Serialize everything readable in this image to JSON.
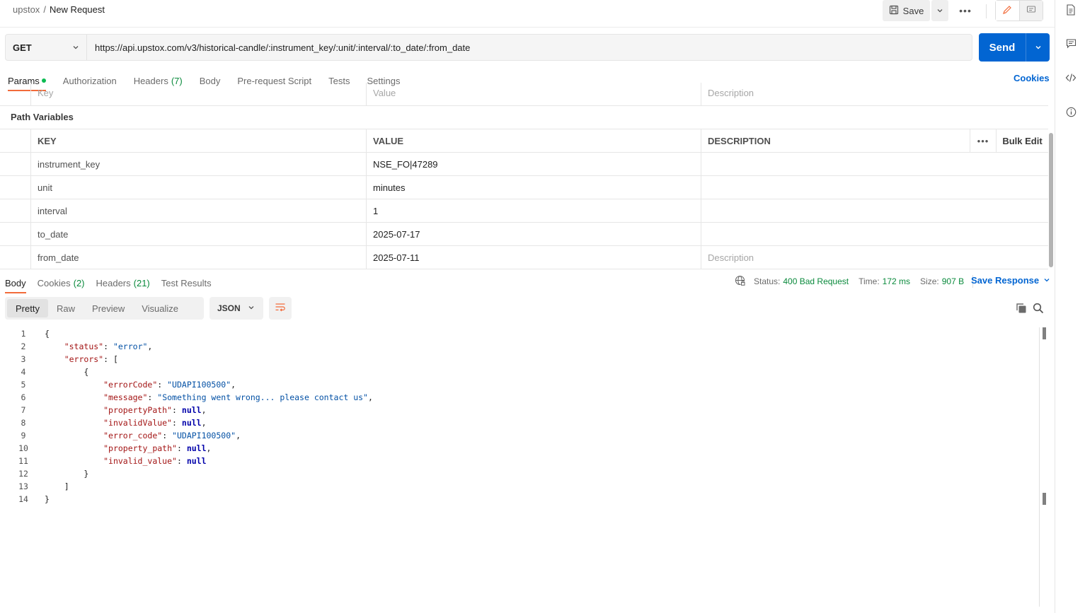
{
  "header": {
    "workspace": "upstox",
    "separator": "/",
    "request_name": "New Request",
    "save_label": "Save",
    "more_label": "•••"
  },
  "request": {
    "method": "GET",
    "url": "https://api.upstox.com/v3/historical-candle/:instrument_key/:unit/:interval/:to_date/:from_date",
    "send_label": "Send"
  },
  "req_tabs": {
    "params": "Params",
    "authorization": "Authorization",
    "headers": "Headers",
    "headers_count": "(7)",
    "body": "Body",
    "pre_request": "Pre-request Script",
    "tests": "Tests",
    "settings": "Settings",
    "cookies": "Cookies"
  },
  "query_params": {
    "key_placeholder": "Key",
    "value_placeholder": "Value",
    "desc_placeholder": "Description"
  },
  "path_variables": {
    "title": "Path Variables",
    "col_key": "KEY",
    "col_value": "VALUE",
    "col_desc": "DESCRIPTION",
    "more_label": "•••",
    "bulk_edit": "Bulk Edit",
    "rows": [
      {
        "key": "instrument_key",
        "value": "NSE_FO|47289",
        "desc": ""
      },
      {
        "key": "unit",
        "value": "minutes",
        "desc": ""
      },
      {
        "key": "interval",
        "value": "1",
        "desc": ""
      },
      {
        "key": "to_date",
        "value": "2025-07-17",
        "desc": ""
      },
      {
        "key": "from_date",
        "value": "2025-07-11",
        "desc_placeholder": "Description"
      }
    ]
  },
  "response": {
    "tabs": {
      "body": "Body",
      "cookies": "Cookies",
      "cookies_count": "(2)",
      "headers": "Headers",
      "headers_count": "(21)",
      "test_results": "Test Results"
    },
    "status_label": "Status:",
    "status_value": "400 Bad Request",
    "time_label": "Time:",
    "time_value": "172 ms",
    "size_label": "Size:",
    "size_value": "907 B",
    "save_response": "Save Response",
    "views": [
      "Pretty",
      "Raw",
      "Preview",
      "Visualize"
    ],
    "format": "JSON",
    "lines": [
      {
        "n": "1",
        "parts": [
          [
            "p",
            "{"
          ]
        ]
      },
      {
        "n": "2",
        "parts": [
          [
            "p",
            "    "
          ],
          [
            "k",
            "\"status\""
          ],
          [
            "p",
            ": "
          ],
          [
            "s",
            "\"error\""
          ],
          [
            "p",
            ","
          ]
        ]
      },
      {
        "n": "3",
        "parts": [
          [
            "p",
            "    "
          ],
          [
            "k",
            "\"errors\""
          ],
          [
            "p",
            ": ["
          ]
        ]
      },
      {
        "n": "4",
        "parts": [
          [
            "p",
            "        {"
          ]
        ]
      },
      {
        "n": "5",
        "parts": [
          [
            "p",
            "            "
          ],
          [
            "k",
            "\"errorCode\""
          ],
          [
            "p",
            ": "
          ],
          [
            "s",
            "\"UDAPI100500\""
          ],
          [
            "p",
            ","
          ]
        ]
      },
      {
        "n": "6",
        "parts": [
          [
            "p",
            "            "
          ],
          [
            "k",
            "\"message\""
          ],
          [
            "p",
            ": "
          ],
          [
            "s",
            "\"Something went wrong... please contact us\""
          ],
          [
            "p",
            ","
          ]
        ]
      },
      {
        "n": "7",
        "parts": [
          [
            "p",
            "            "
          ],
          [
            "k",
            "\"propertyPath\""
          ],
          [
            "p",
            ": "
          ],
          [
            "n",
            "null"
          ],
          [
            "p",
            ","
          ]
        ]
      },
      {
        "n": "8",
        "parts": [
          [
            "p",
            "            "
          ],
          [
            "k",
            "\"invalidValue\""
          ],
          [
            "p",
            ": "
          ],
          [
            "n",
            "null"
          ],
          [
            "p",
            ","
          ]
        ]
      },
      {
        "n": "9",
        "parts": [
          [
            "p",
            "            "
          ],
          [
            "k",
            "\"error_code\""
          ],
          [
            "p",
            ": "
          ],
          [
            "s",
            "\"UDAPI100500\""
          ],
          [
            "p",
            ","
          ]
        ]
      },
      {
        "n": "10",
        "parts": [
          [
            "p",
            "            "
          ],
          [
            "k",
            "\"property_path\""
          ],
          [
            "p",
            ": "
          ],
          [
            "n",
            "null"
          ],
          [
            "p",
            ","
          ]
        ]
      },
      {
        "n": "11",
        "parts": [
          [
            "p",
            "            "
          ],
          [
            "k",
            "\"invalid_value\""
          ],
          [
            "p",
            ": "
          ],
          [
            "n",
            "null"
          ]
        ]
      },
      {
        "n": "12",
        "parts": [
          [
            "p",
            "        }"
          ]
        ]
      },
      {
        "n": "13",
        "parts": [
          [
            "p",
            "    ]"
          ]
        ]
      },
      {
        "n": "14",
        "parts": [
          [
            "p",
            "}"
          ]
        ]
      }
    ]
  },
  "colors": {
    "accent": "#0265d2",
    "tab_indicator": "#f26b3a",
    "success": "#0a8a3c"
  }
}
